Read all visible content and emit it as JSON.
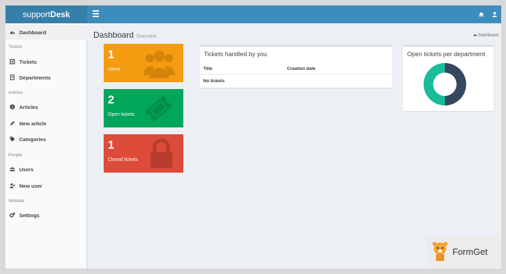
{
  "app": {
    "brand_light": "support",
    "brand_bold": "Desk"
  },
  "colors": {
    "topbar": "#3c8dbc",
    "brand_bg": "#367fa9",
    "users_tile": "#f39c12",
    "open_tile": "#00a65a",
    "closed_tile": "#dd4b39",
    "donut_a": "#34495e",
    "donut_b": "#1abc9c"
  },
  "topbar": {
    "menu_icon": "hamburger-icon",
    "icons": [
      "home-icon",
      "user-icon"
    ]
  },
  "sidebar": {
    "items": [
      {
        "label": "Dashboard",
        "icon": "dashboard-icon",
        "active": true
      },
      {
        "header": "Tickets"
      },
      {
        "label": "Tickets",
        "icon": "ticket-icon"
      },
      {
        "label": "Departments",
        "icon": "building-icon"
      },
      {
        "header": "Articles"
      },
      {
        "label": "Articles",
        "icon": "info-icon"
      },
      {
        "label": "New article",
        "icon": "pencil-icon"
      },
      {
        "label": "Categories",
        "icon": "tags-icon"
      },
      {
        "header": "People"
      },
      {
        "label": "Users",
        "icon": "users-icon"
      },
      {
        "label": "New user",
        "icon": "user-plus-icon"
      },
      {
        "header": "Website"
      },
      {
        "label": "Settings",
        "icon": "cogs-icon"
      }
    ]
  },
  "page": {
    "title": "Dashboard",
    "subtitle": "Overview",
    "breadcrumb": "Dashboard"
  },
  "tiles": [
    {
      "value": "1",
      "label": "Users",
      "icon": "users-icon"
    },
    {
      "value": "2",
      "label": "Open tickets",
      "icon": "ticket-icon"
    },
    {
      "value": "1",
      "label": "Closed tickets",
      "icon": "lock-icon"
    }
  ],
  "tickets_box": {
    "title": "Tickets handled by you",
    "columns": [
      "Title",
      "Creation date"
    ],
    "empty_text": "No tickets"
  },
  "department_box": {
    "title": "Open tickets per department"
  },
  "chart_data": {
    "type": "pie",
    "categories": [
      "",
      ""
    ],
    "values": [
      50,
      50
    ],
    "colors": [
      "#34495e",
      "#1abc9c"
    ]
  },
  "watermark": {
    "text": "FormGet"
  }
}
